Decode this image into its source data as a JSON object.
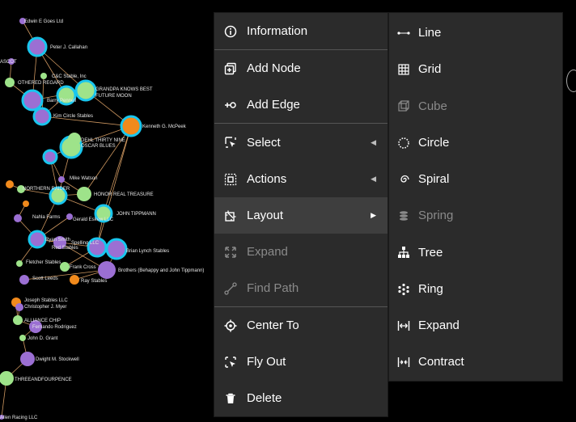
{
  "graph": {
    "nodes": [
      {
        "label": "Edwin E Goes Ltd"
      },
      {
        "label": "Peter J. Callahan"
      },
      {
        "label": "ASCOT"
      },
      {
        "label": "C&C Stable, Inc"
      },
      {
        "label": "OTHERED REGARD"
      },
      {
        "label": "GRANDPA KNOWS BEST"
      },
      {
        "label": "FUTURE MOON"
      },
      {
        "label": "Barry Pennell"
      },
      {
        "label": "Kim Circle Stables"
      },
      {
        "label": "Kenneth G. McPeek"
      },
      {
        "label": "DEHL THIRTY NINE"
      },
      {
        "label": "OSCAR BLUES"
      },
      {
        "label": "Mike Watson"
      },
      {
        "label": "NORTHERN RAIDER"
      },
      {
        "label": "HONOR REAL TREASURE"
      },
      {
        "label": "JOHN TIPPMANN"
      },
      {
        "label": "Gerald Eskew LLC"
      },
      {
        "label": "Nahla Farms"
      },
      {
        "label": "Ryan Smith"
      },
      {
        "label": "Spelling LLC"
      },
      {
        "label": "Red Stables"
      },
      {
        "label": "Fletcher Stables"
      },
      {
        "label": "Brian Lynch Stables"
      },
      {
        "label": "Frank Cross"
      },
      {
        "label": "Scott Leeds"
      },
      {
        "label": "Ray Stables"
      },
      {
        "label": "Brothers (Behappy and John Tippmann)"
      },
      {
        "label": "Joseph Stables LLC"
      },
      {
        "label": "Christopher J. Myer"
      },
      {
        "label": "ALLIANCE CHIP"
      },
      {
        "label": "Fernando Rodriguez"
      },
      {
        "label": "John D. Grant"
      },
      {
        "label": "Dwight M. Stockwell"
      },
      {
        "label": "THREEANDFOURPENCE"
      },
      {
        "label": "Allen Racing LLC"
      }
    ]
  },
  "main_menu": {
    "items": [
      {
        "label": "Information",
        "icon": "info-icon"
      },
      {
        "label": "Add Node",
        "icon": "add-node-icon"
      },
      {
        "label": "Add Edge",
        "icon": "add-edge-icon"
      },
      {
        "label": "Select",
        "icon": "select-icon"
      },
      {
        "label": "Actions",
        "icon": "actions-icon"
      },
      {
        "label": "Layout",
        "icon": "layout-icon"
      },
      {
        "label": "Expand",
        "icon": "expand-icon"
      },
      {
        "label": "Find Path",
        "icon": "find-path-icon"
      },
      {
        "label": "Center To",
        "icon": "center-icon"
      },
      {
        "label": "Fly Out",
        "icon": "fly-out-icon"
      },
      {
        "label": "Delete",
        "icon": "trash-icon"
      }
    ]
  },
  "layout_submenu": {
    "items": [
      {
        "label": "Line",
        "icon": "line-icon"
      },
      {
        "label": "Grid",
        "icon": "grid-icon"
      },
      {
        "label": "Cube",
        "icon": "cube-icon"
      },
      {
        "label": "Circle",
        "icon": "circle-icon"
      },
      {
        "label": "Spiral",
        "icon": "spiral-icon"
      },
      {
        "label": "Spring",
        "icon": "spring-icon"
      },
      {
        "label": "Tree",
        "icon": "tree-icon"
      },
      {
        "label": "Ring",
        "icon": "ring-icon"
      },
      {
        "label": "Expand",
        "icon": "expand-layout-icon"
      },
      {
        "label": "Contract",
        "icon": "contract-icon"
      }
    ]
  },
  "colors": {
    "menu_bg": "#2b2b2b",
    "menu_active": "#3e3e3e",
    "node_purple": "#9b6fd3",
    "node_green": "#9ee38a",
    "node_orange": "#f18a1c",
    "node_highlight": "#19c6ee",
    "edge": "#f0b070"
  }
}
